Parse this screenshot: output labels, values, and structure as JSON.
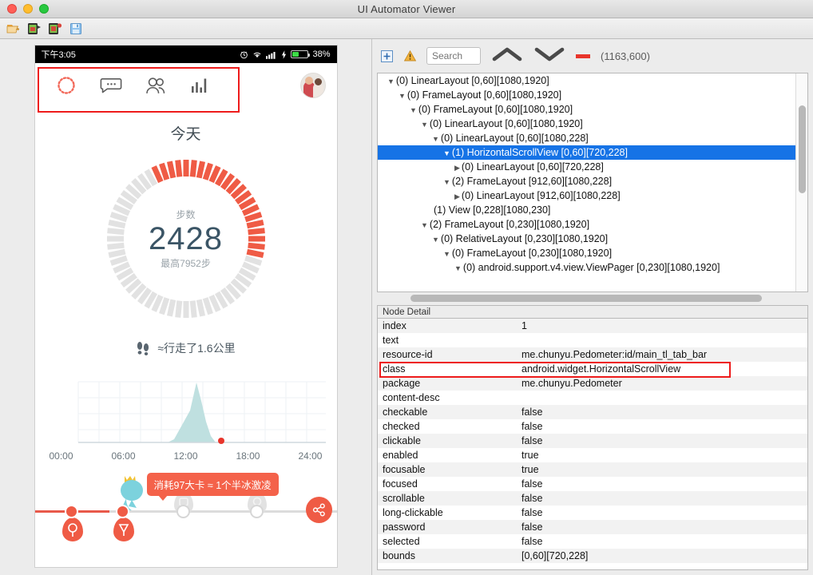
{
  "window": {
    "title": "UI Automator Viewer",
    "traffic_lights": [
      "close",
      "minimize",
      "zoom"
    ]
  },
  "toolbar": {
    "items": [
      {
        "name": "open-icon",
        "label": "Open"
      },
      {
        "name": "device-screenshot-icon",
        "label": "Device Screenshot (uiautomator dump)"
      },
      {
        "name": "device-screenshot-compressed-icon",
        "label": "Device Screenshot with Compressed Hierarchy"
      },
      {
        "name": "save-icon",
        "label": "Save"
      }
    ]
  },
  "phone": {
    "status_bar": {
      "time": "下午3:05",
      "battery_text": "38%",
      "icons": [
        "alarm-icon",
        "wifi-icon",
        "signal-icon",
        "charging-icon",
        "battery-icon"
      ]
    },
    "tab_bar": {
      "tabs": [
        {
          "name": "tab-circle",
          "icon": "dotted-circle-icon"
        },
        {
          "name": "tab-messages",
          "icon": "speech-bubble-icon"
        },
        {
          "name": "tab-friends",
          "icon": "friends-icon"
        },
        {
          "name": "tab-stats",
          "icon": "bar-chart-icon"
        }
      ],
      "avatar": "user-avatar"
    },
    "selection_box_color": "#ee1b1b",
    "today_title": "今天",
    "ring": {
      "label": "步数",
      "value": "2428",
      "sub": "最高7952步",
      "progress_color": "#ef5b45",
      "track_color": "#e2e2e2",
      "percent": 30
    },
    "walk": {
      "icon": "footprints-icon",
      "text": "≈行走了1.6公里"
    },
    "chart": {
      "x_ticks": [
        "00:00",
        "06:00",
        "12:00",
        "18:00",
        "24:00"
      ],
      "area_color": "#bfe0e0",
      "marker_color": "#e8352b"
    },
    "bottom": {
      "tooltip": "消耗97大卡 ≈ 1个半冰激凌",
      "share_icon": "share-icon",
      "markers": [
        {
          "name": "milestone-1",
          "state": "done"
        },
        {
          "name": "milestone-2",
          "state": "done"
        },
        {
          "name": "milestone-3",
          "state": "todo"
        },
        {
          "name": "milestone-4",
          "state": "todo"
        }
      ]
    }
  },
  "tree_panel": {
    "toolbar": {
      "expand_icon": "expand-all-icon",
      "warning_icon": "warning-icon",
      "search_placeholder": "Search",
      "up_icon": "chevron-up-icon",
      "down_icon": "chevron-down-icon",
      "dash_icon": "dash-icon",
      "dash_color": "#e8352b",
      "coordinates": "(1163,600)"
    },
    "rows": [
      {
        "indent": 0,
        "toggle": "down",
        "text": "(0) LinearLayout [0,60][1080,1920]",
        "selected": false
      },
      {
        "indent": 1,
        "toggle": "down",
        "text": "(0) FrameLayout [0,60][1080,1920]",
        "selected": false
      },
      {
        "indent": 2,
        "toggle": "down",
        "text": "(0) FrameLayout [0,60][1080,1920]",
        "selected": false
      },
      {
        "indent": 3,
        "toggle": "down",
        "text": "(0) LinearLayout [0,60][1080,1920]",
        "selected": false
      },
      {
        "indent": 4,
        "toggle": "down",
        "text": "(0) LinearLayout [0,60][1080,228]",
        "selected": false
      },
      {
        "indent": 5,
        "toggle": "down",
        "text": "(1) HorizontalScrollView [0,60][720,228]",
        "selected": true
      },
      {
        "indent": 6,
        "toggle": "right",
        "text": "(0) LinearLayout [0,60][720,228]",
        "selected": false
      },
      {
        "indent": 5,
        "toggle": "down",
        "text": "(2) FrameLayout [912,60][1080,228]",
        "selected": false
      },
      {
        "indent": 6,
        "toggle": "right",
        "text": "(0) LinearLayout [912,60][1080,228]",
        "selected": false
      },
      {
        "indent": 4,
        "toggle": "none",
        "text": "(1) View [0,228][1080,230]",
        "selected": false
      },
      {
        "indent": 3,
        "toggle": "down",
        "text": "(2) FrameLayout [0,230][1080,1920]",
        "selected": false
      },
      {
        "indent": 4,
        "toggle": "down",
        "text": "(0) RelativeLayout [0,230][1080,1920]",
        "selected": false
      },
      {
        "indent": 5,
        "toggle": "down",
        "text": "(0) FrameLayout [0,230][1080,1920]",
        "selected": false
      },
      {
        "indent": 6,
        "toggle": "down",
        "text": "(0) android.support.v4.view.ViewPager [0,230][1080,1920]",
        "selected": false
      }
    ]
  },
  "node_detail": {
    "header": "Node Detail",
    "highlight_color": "#ee1b1b",
    "highlighted_key": "resource-id",
    "rows": [
      {
        "key": "index",
        "value": "1"
      },
      {
        "key": "text",
        "value": ""
      },
      {
        "key": "resource-id",
        "value": "me.chunyu.Pedometer:id/main_tl_tab_bar"
      },
      {
        "key": "class",
        "value": "android.widget.HorizontalScrollView"
      },
      {
        "key": "package",
        "value": "me.chunyu.Pedometer"
      },
      {
        "key": "content-desc",
        "value": ""
      },
      {
        "key": "checkable",
        "value": "false"
      },
      {
        "key": "checked",
        "value": "false"
      },
      {
        "key": "clickable",
        "value": "false"
      },
      {
        "key": "enabled",
        "value": "true"
      },
      {
        "key": "focusable",
        "value": "true"
      },
      {
        "key": "focused",
        "value": "false"
      },
      {
        "key": "scrollable",
        "value": "false"
      },
      {
        "key": "long-clickable",
        "value": "false"
      },
      {
        "key": "password",
        "value": "false"
      },
      {
        "key": "selected",
        "value": "false"
      },
      {
        "key": "bounds",
        "value": "[0,60][720,228]"
      }
    ]
  }
}
